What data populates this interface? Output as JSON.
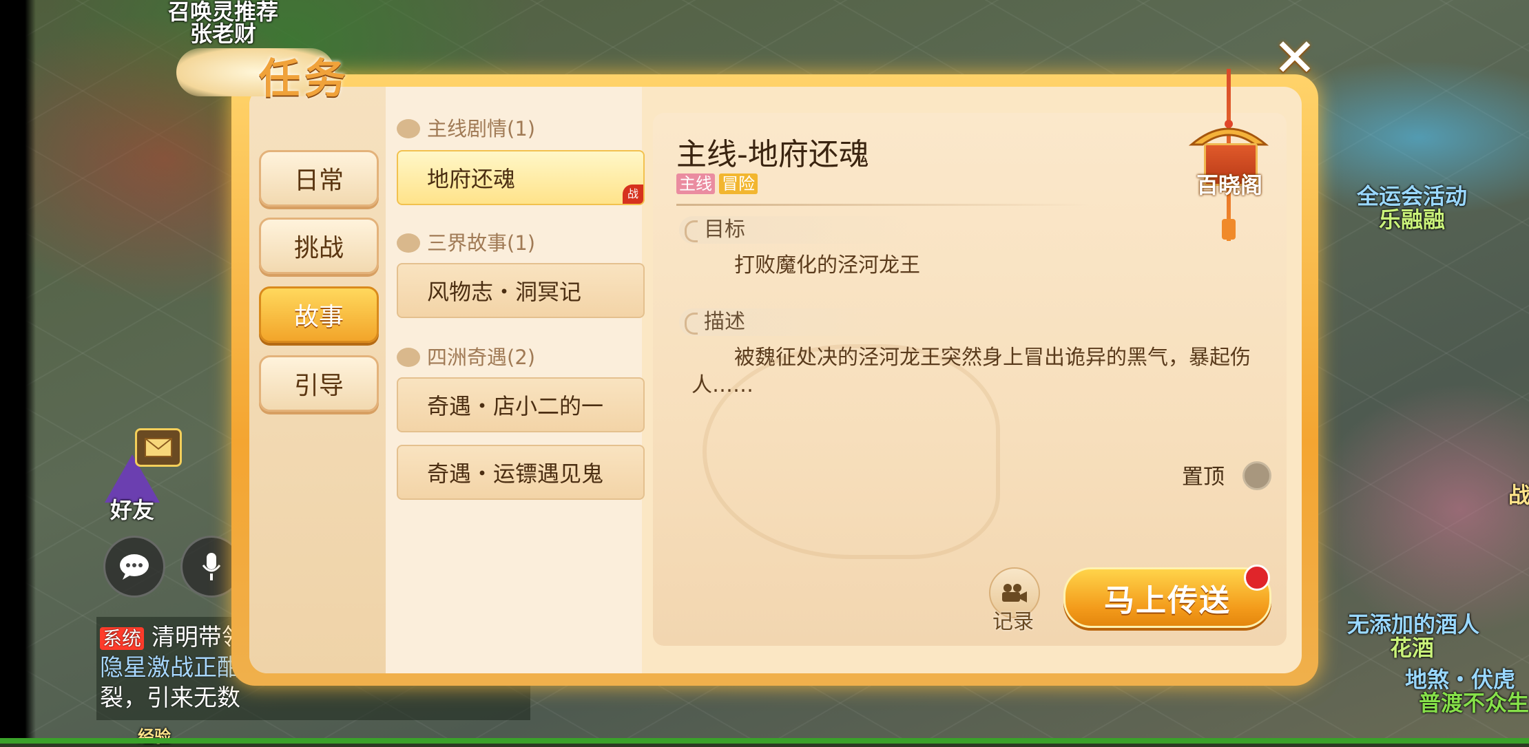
{
  "scene": {
    "top_left_label_1": "召唤灵推荐",
    "top_left_label_2": "张老财",
    "right_label_1": "全运会活动",
    "right_label_2": "乐融融",
    "friends_label": "好友",
    "chat_tag_system": "系统",
    "chat_line_1": "清明带领",
    "chat_line_2": "隐星激战正酣",
    "chat_line_3": "裂，引来无数",
    "bottom_left_label": "经验",
    "bottom_right_npc_1": "无添加的酒人",
    "bottom_right_npc_2": "花酒",
    "bottom_right_npc_3": "地煞・伏虎",
    "bottom_right_npc_4": "普渡不众生",
    "far_right_partial": "战"
  },
  "panel": {
    "title": "任务",
    "close_icon": "close-icon",
    "tabs": [
      {
        "label": "日常",
        "active": false
      },
      {
        "label": "挑战",
        "active": false
      },
      {
        "label": "故事",
        "active": true
      },
      {
        "label": "引导",
        "active": false
      }
    ],
    "categories": [
      {
        "header": "主线剧情(1)",
        "items": [
          {
            "label": "地府还魂",
            "active": true,
            "badge": "战"
          }
        ]
      },
      {
        "header": "三界故事(1)",
        "items": [
          {
            "label": "风物志・洞冥记"
          }
        ]
      },
      {
        "header": "四洲奇遇(2)",
        "items": [
          {
            "label": "奇遇・店小二的一"
          },
          {
            "label": "奇遇・运镖遇见鬼"
          }
        ]
      }
    ],
    "detail": {
      "title": "主线-地府还魂",
      "tags": [
        "主线",
        "冒险"
      ],
      "goal_header": "目标",
      "goal_text": "打败魔化的泾河龙王",
      "desc_header": "描述",
      "desc_text_1": "被魏征处决的泾河龙王突然身上冒出诡异的黑气，暴起伤",
      "desc_text_2": "人……",
      "pin_label": "置顶",
      "pavilion_label": "百晓阁",
      "record_label": "记录",
      "teleport_label": "马上传送"
    }
  },
  "colors": {
    "accent_gold": "#f2a52a",
    "tag_main": "#ea8ca0",
    "tag_adventure": "#f2b630",
    "notification_red": "#e0252a"
  }
}
